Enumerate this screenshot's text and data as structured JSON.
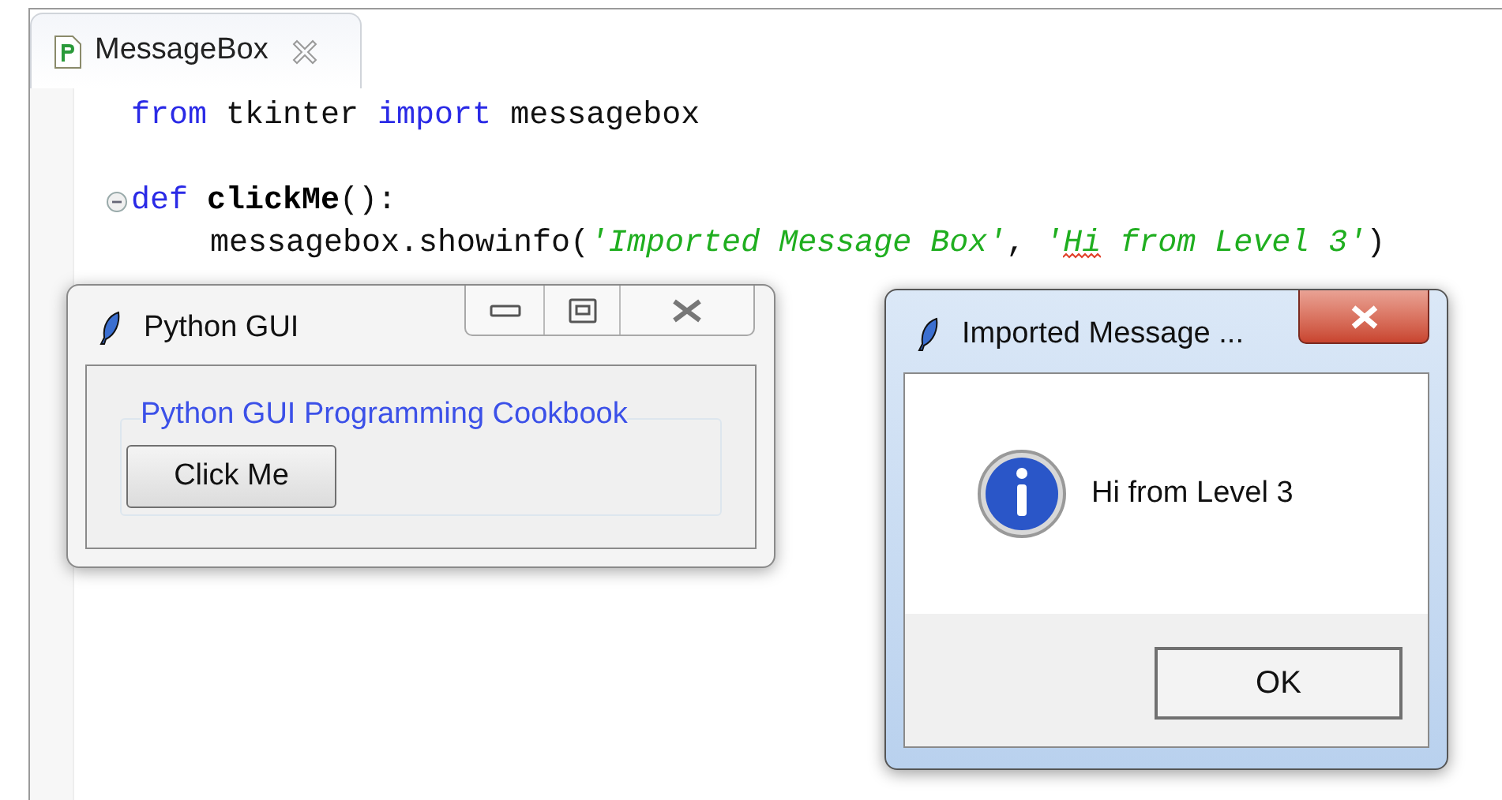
{
  "editor": {
    "tab": {
      "title": "MessageBox",
      "selected": true
    },
    "lines": [
      {
        "kind": "code",
        "tokens": [
          {
            "text": "from",
            "kind": "keyword"
          },
          {
            "text": " tkinter ",
            "kind": "plain"
          },
          {
            "text": "import",
            "kind": "keyword"
          },
          {
            "text": " messagebox",
            "kind": "plain"
          }
        ]
      },
      {
        "kind": "blank"
      },
      {
        "kind": "code",
        "tokens": [
          {
            "text": "def ",
            "kind": "keyword"
          },
          {
            "text": "clickMe",
            "kind": "function"
          },
          {
            "text": "():",
            "kind": "plain"
          }
        ],
        "children": [
          {
            "kind": "code",
            "tokens": [
              {
                "text": "messagebox.showinfo(",
                "kind": "plain"
              },
              {
                "text": "'Imported Message Box'",
                "kind": "string"
              },
              {
                "text": ", ",
                "kind": "plain"
              },
              {
                "text": "'",
                "kind": "string"
              },
              {
                "text": "Hi",
                "kind": "string",
                "misspelled": true
              },
              {
                "text": " from Level 3'",
                "kind": "string"
              },
              {
                "text": ")",
                "kind": "plain"
              }
            ]
          }
        ]
      }
    ]
  },
  "windows": [
    {
      "kind": "app",
      "title": "Python GUI",
      "labelframe": "Python GUI Programming Cookbook",
      "button": "Click Me"
    },
    {
      "kind": "messagebox",
      "title": "Imported Message ...",
      "message": "Hi from Level 3",
      "button": "OK"
    }
  ]
}
